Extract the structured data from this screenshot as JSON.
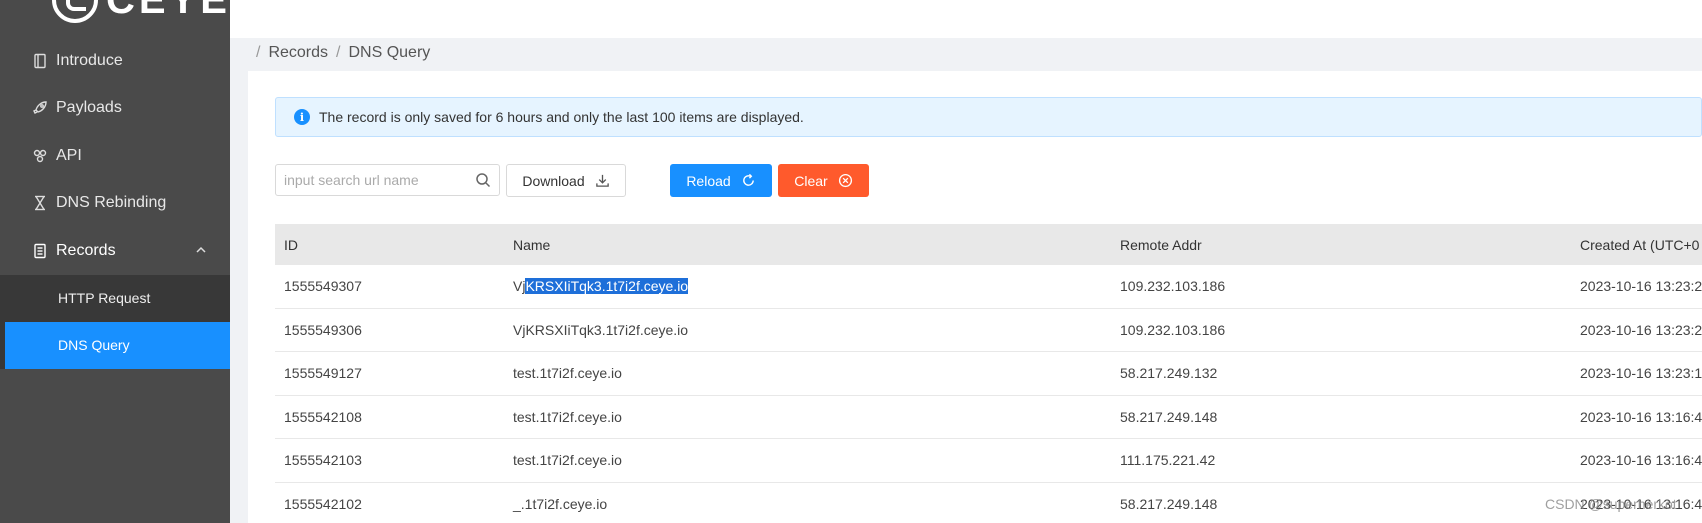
{
  "brand": {
    "logo_text": "CEYE"
  },
  "sidebar": {
    "items": [
      {
        "label": "Introduce",
        "icon": "book-icon"
      },
      {
        "label": "Payloads",
        "icon": "rocket-icon"
      },
      {
        "label": "API",
        "icon": "api-icon"
      },
      {
        "label": "DNS Rebinding",
        "icon": "hourglass-icon"
      },
      {
        "label": "Records",
        "icon": "records-icon"
      }
    ],
    "submenu": [
      {
        "label": "HTTP Request"
      },
      {
        "label": "DNS Query"
      }
    ]
  },
  "breadcrumb": {
    "sep": "/",
    "first": "Records",
    "second": "DNS Query"
  },
  "alert": {
    "text": "The record is only saved for 6 hours and only the last 100 items are displayed."
  },
  "toolbar": {
    "search_placeholder": "input search url name",
    "download_label": "Download",
    "reload_label": "Reload",
    "clear_label": "Clear"
  },
  "table": {
    "headers": [
      "ID",
      "Name",
      "Remote Addr",
      "Created At (UTC+0"
    ],
    "rows": [
      {
        "id": "1555549307",
        "name_pre": "Vj",
        "name_sel": "KRSXIiTqk3.1t7i2f.ceye.io",
        "addr": "109.232.103.186",
        "time": "2023-10-16 13:23:2"
      },
      {
        "id": "1555549306",
        "name": "VjKRSXIiTqk3.1t7i2f.ceye.io",
        "addr": "109.232.103.186",
        "time": "2023-10-16 13:23:2"
      },
      {
        "id": "1555549127",
        "name": "test.1t7i2f.ceye.io",
        "addr": "58.217.249.132",
        "time": "2023-10-16 13:23:1"
      },
      {
        "id": "1555542108",
        "name": "test.1t7i2f.ceye.io",
        "addr": "58.217.249.148",
        "time": "2023-10-16 13:16:4"
      },
      {
        "id": "1555542103",
        "name": "test.1t7i2f.ceye.io",
        "addr": "111.175.221.42",
        "time": "2023-10-16 13:16:4"
      },
      {
        "id": "1555542102",
        "name": "_.1t7i2f.ceye.io",
        "addr": "58.217.249.148",
        "time": "2023-10-16 13:16:4"
      }
    ]
  },
  "watermark": "CSDN @superherkot",
  "colors": {
    "primary": "#1890ff",
    "danger": "#ff5a2c",
    "sidebar": "#4a4a4a"
  }
}
